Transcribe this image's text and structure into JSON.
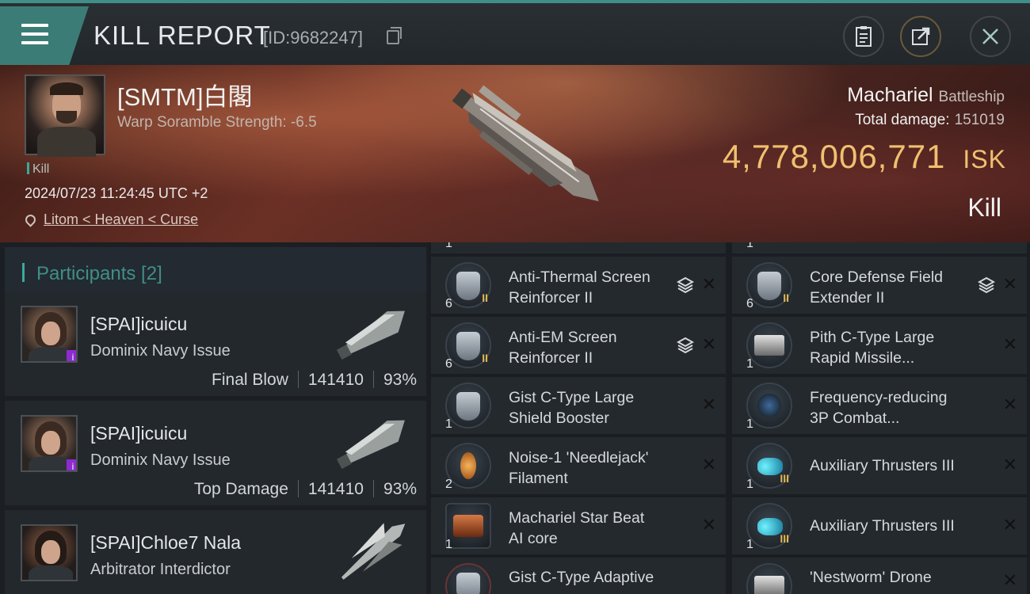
{
  "header": {
    "title": "KILL REPORT",
    "report_id": "[ID:9682247]",
    "icons": [
      "menu-icon",
      "copy-icon",
      "clipboard-icon",
      "share-icon",
      "close-icon"
    ]
  },
  "victim": {
    "name": "[SMTM]白閣",
    "scramble": "Warp Soramble Strength: -6.5",
    "kill_tag": "Kill",
    "datetime": "2024/07/23 11:24:45 UTC +2",
    "location": "Litom < Heaven < Curse",
    "ship_name": "Machariel",
    "ship_class": "Battleship",
    "total_damage_label": "Total damage:",
    "total_damage": "151019",
    "isk_value": "4,778,006,771",
    "isk_currency": "ISK",
    "result": "Kill"
  },
  "participants": {
    "title": "Participants [2]",
    "items": [
      {
        "name": "[SPAI]icuicu",
        "ship": "Dominix Navy Issue",
        "role": "Final Blow",
        "damage": "141410",
        "percent": "93%",
        "badge": "i"
      },
      {
        "name": "[SPAI]icuicu",
        "ship": "Dominix Navy Issue",
        "role": "Top Damage",
        "damage": "141410",
        "percent": "93%",
        "badge": "i"
      },
      {
        "name": "[SPAI]Chloe7 Nala",
        "ship": "Arbitrator Interdictor"
      }
    ]
  },
  "modules": {
    "left": [
      {
        "qty": "1",
        "name": ""
      },
      {
        "qty": "6",
        "name": "Anti-Thermal Screen\nReinforcer II",
        "tier": "II",
        "stack": true,
        "icon": "shield-module-icon"
      },
      {
        "qty": "6",
        "name": "Anti-EM Screen\nReinforcer II",
        "tier": "II",
        "stack": true,
        "icon": "shield-module-icon"
      },
      {
        "qty": "1",
        "name": "Gist C-Type Large\nShield Booster",
        "icon": "shield-booster-icon"
      },
      {
        "qty": "2",
        "name": " Noise-1 'Needlejack'\nFilament",
        "icon": "filament-icon",
        "style": "orange"
      },
      {
        "qty": "1",
        "name": "Machariel Star Beat\nAI core",
        "icon": "ai-core-icon",
        "style": "red"
      },
      {
        "qty": "",
        "name": "Gist C-Type Adaptive",
        "icon": "shield-module-icon"
      }
    ],
    "right": [
      {
        "qty": "1",
        "name": ""
      },
      {
        "qty": "6",
        "name": "Core Defense Field\nExtender II",
        "tier": "II",
        "stack": true,
        "icon": "shield-module-icon"
      },
      {
        "qty": "1",
        "name": "Pith C-Type Large\nRapid Missile...",
        "icon": "missile-launcher-icon",
        "style": "grey"
      },
      {
        "qty": "1",
        "name": "Frequency-reducing\n3P Combat...",
        "icon": "combat-module-icon",
        "style": "dark"
      },
      {
        "qty": "1",
        "name": "Auxiliary Thrusters III",
        "tier": "III",
        "icon": "thruster-icon",
        "style": "cyan"
      },
      {
        "qty": "1",
        "name": "Auxiliary Thrusters III",
        "tier": "III",
        "icon": "thruster-icon",
        "style": "cyan"
      },
      {
        "qty": "",
        "name": "'Nestworm' Drone",
        "icon": "drone-icon",
        "style": "grey"
      }
    ]
  },
  "colors": {
    "accent": "#3fa79a",
    "isk": "#f0c070",
    "badge": "#8d2bd1"
  }
}
